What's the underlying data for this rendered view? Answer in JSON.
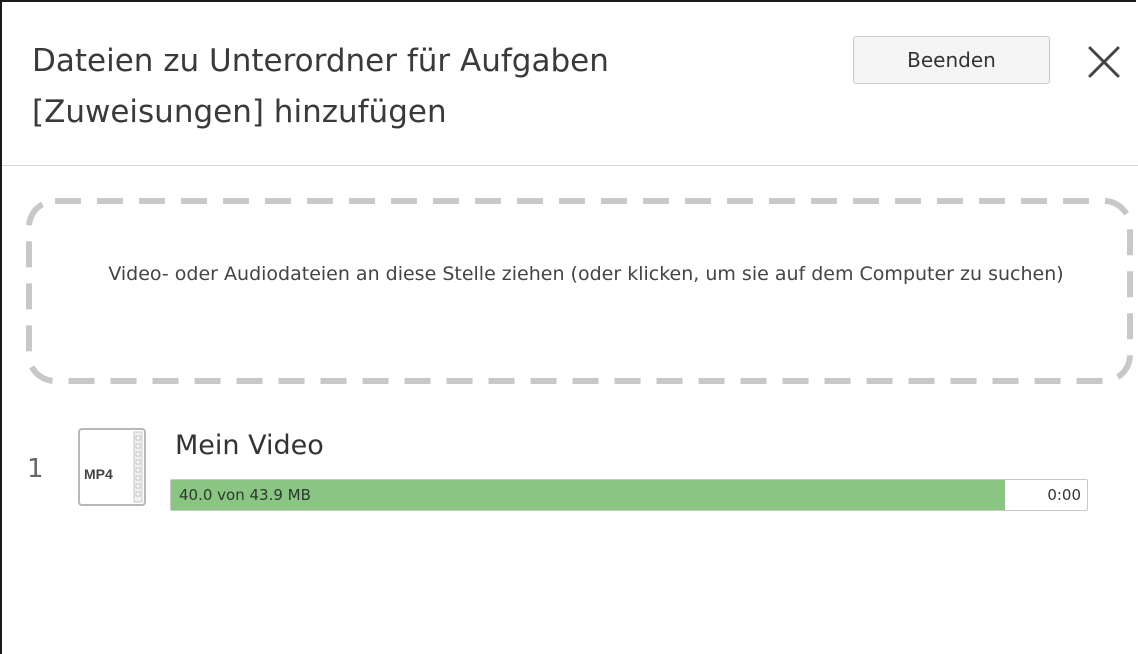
{
  "dialog": {
    "title": "Dateien zu Unterordner für Aufgaben [Zuweisungen] hinzufügen",
    "done_label": "Beenden"
  },
  "dropzone": {
    "text": "Video- oder Audiodateien an diese Stelle ziehen (oder klicken, um sie auf dem Computer zu suchen)"
  },
  "uploads": [
    {
      "index": "1",
      "file_type": "MP4",
      "name": "Mein Video",
      "progress_text": "40.0 von 43.9 MB",
      "progress_fraction": 0.911,
      "time": "0:00"
    }
  ],
  "colors": {
    "progress": "#8ac583",
    "dropzone_border": "#c8c8c8"
  }
}
